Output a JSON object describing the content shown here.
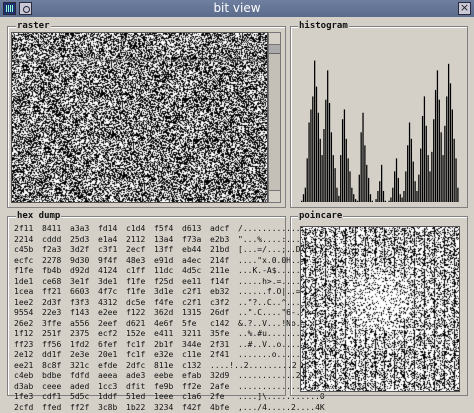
{
  "window": {
    "title": "bit view"
  },
  "panels": {
    "raster": {
      "label": "raster"
    },
    "histogram": {
      "label": "histogram",
      "bins": [
        0.02,
        0.06,
        0.1,
        0.28,
        0.5,
        0.58,
        0.66,
        0.88,
        0.72,
        0.56,
        0.4,
        0.3,
        0.46,
        0.64,
        0.82,
        0.62,
        0.44,
        0.3,
        0.22,
        0.1,
        0.05,
        0.3,
        0.52,
        0.58,
        0.4,
        0.28,
        0.2,
        0.1,
        0.06,
        0.03,
        0.02,
        0.18,
        0.44,
        0.56,
        0.36,
        0.24,
        0.16,
        0.06,
        0.02,
        0.01,
        0.03,
        0.08,
        0.14,
        0.24,
        0.08,
        0.02,
        0.01,
        0.02,
        0.04,
        0.1,
        0.2,
        0.28,
        0.16,
        0.06,
        0.04,
        0.08,
        0.2,
        0.36,
        0.5,
        0.4,
        0.26,
        0.14,
        0.08,
        0.18,
        0.34,
        0.54,
        0.66,
        0.48,
        0.3,
        0.2,
        0.32,
        0.52,
        0.7,
        0.82,
        0.64,
        0.44,
        0.3,
        0.48,
        0.66,
        0.86,
        0.74,
        0.58,
        0.4,
        0.28,
        0.1,
        0.04
      ]
    },
    "hex_dump": {
      "label": "hex dump",
      "rows": [
        [
          "2f11",
          "8411",
          "a3a3",
          "fd14",
          "c1d4",
          "f5f4",
          "d613",
          "adcf",
          "/..............."
        ],
        [
          "2214",
          "cddd",
          "25d3",
          "e1a4",
          "2112",
          "13a4",
          "f73a",
          "e2b3",
          "\"...%....:...."
        ],
        [
          "c45b",
          "f2a3",
          "3d2f",
          "c3f1",
          "2ecf",
          "13ff",
          "eb44",
          "21bd",
          "[...=/...;..D.!."
        ],
        [
          "ecfc",
          "2278",
          "9d30",
          "9f4f",
          "48e3",
          "e91d",
          "a4ec",
          "214f",
          "....\"x.0.0H.....!O"
        ],
        [
          "f1fe",
          "fb4b",
          "d92d",
          "4124",
          "c1ff",
          "11dc",
          "4d5c",
          "211e",
          "...K.-A$.....M\\!."
        ],
        [
          "1de1",
          "ce68",
          "3e1f",
          "3de1",
          "f1fe",
          "f25d",
          "ee11",
          "f14f",
          ".....h>.=.....].."
        ],
        [
          "1cea",
          "ff21",
          "6603",
          "4f7c",
          "f1fe",
          "3d1e",
          "c2f1",
          "eb32",
          "......f.O|..=....2"
        ],
        [
          "1ee2",
          "2d3f",
          "f3f3",
          "4312",
          "dc5e",
          "f4fe",
          "c2f1",
          "c3f2",
          "..\"?..C..^......."
        ],
        [
          "9554",
          "22e3",
          "f143",
          "e2ee",
          "f122",
          "362d",
          "1315",
          "26df",
          "..\".C....\"6-..&."
        ],
        [
          "26e2",
          "3ffe",
          "a556",
          "2eef",
          "d621",
          "4e6f",
          "5fe",
          "c142",
          "&.?..V...!No...B"
        ],
        [
          "1f12",
          "251f",
          "2375",
          "ecf2",
          "152e",
          "e411",
          "3211",
          "35fe",
          "..%.#u.........5."
        ],
        [
          "ff23",
          "ff56",
          "1fd2",
          "6fef",
          "fc1f",
          "2b1f",
          "344e",
          "2f31",
          "..#..V..o.....4N/1"
        ],
        [
          "2e12",
          "dd1f",
          "2e3e",
          "20e1",
          "fc1f",
          "e32e",
          "c11e",
          "2f41",
          ".......o.......X/A"
        ],
        [
          "ee21",
          "8c8f",
          "321c",
          "efde",
          "2dfc",
          "811e",
          "c132",
          "....!..2.........2"
        ],
        [
          "c4eb",
          "bdbe",
          "fdfd",
          "aeea",
          "ade3",
          "eebe",
          "efab",
          "32d9",
          "............2."
        ],
        [
          "d3ab",
          "ceee",
          "aded",
          "1cc3",
          "dfit",
          "fe9b",
          "ff2e",
          "2afe",
          "..............*."
        ],
        [
          "1fe3",
          "cdf1",
          "5d5c",
          "1ddf",
          "51ed",
          "1eee",
          "c1a6",
          "2fe",
          "....]\\...........0"
        ],
        [
          "2cfd",
          "ffed",
          "ff2f",
          "3c8b",
          "1b22",
          "3234",
          "f42f",
          "4bfe",
          ",.../4.....2....4K"
        ]
      ]
    },
    "poincare": {
      "label": "poincare"
    }
  },
  "colors": {
    "background": "#d4d0c8",
    "titlebar": "#5f6f90",
    "ink": "#000000"
  },
  "icons": {
    "window_menu": "window-menu-icon",
    "options": "options-icon",
    "close": "close-icon"
  },
  "titlebar_buttons": {
    "close_glyph": "×"
  }
}
